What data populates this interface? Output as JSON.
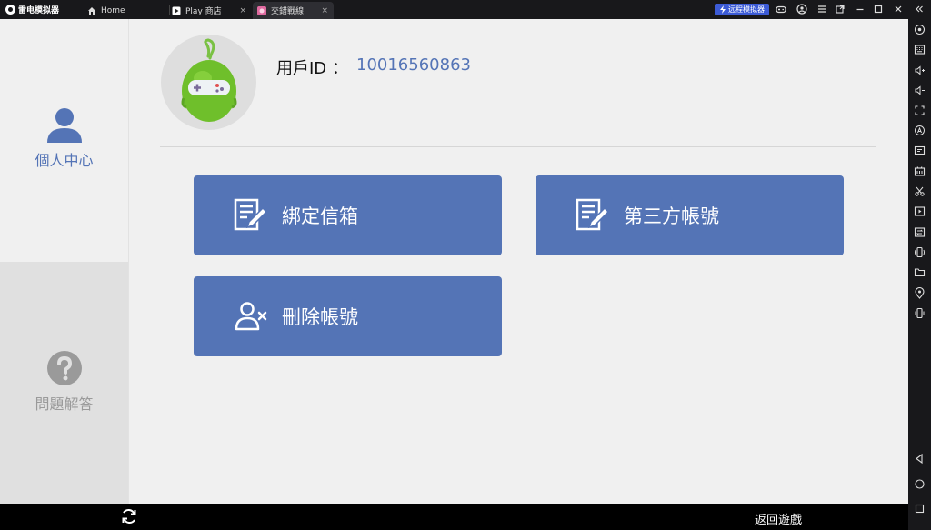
{
  "titlebar": {
    "app_name": "雷电模拟器",
    "tabs": [
      {
        "label": "Home"
      },
      {
        "label": "Play 商店"
      },
      {
        "label": "交錯戰線"
      }
    ],
    "close_glyph": "×",
    "remote_label": "远程模拟器"
  },
  "account": {
    "user_label": "用戶ID ：",
    "user_id": "10016560863"
  },
  "nav": {
    "items": [
      {
        "label": "個人中心"
      },
      {
        "label": "問題解答"
      }
    ]
  },
  "actions": {
    "bind_email": "綁定信箱",
    "third_party": "第三方帳號",
    "delete_account": "刪除帳號"
  },
  "bottom": {
    "back_to_game": "返回遊戲"
  },
  "colors": {
    "accent": "#5474b6",
    "nav_active": "#5474b6",
    "nav_inactive": "#9a9a9a",
    "remote_button": "#3c5bd6"
  }
}
